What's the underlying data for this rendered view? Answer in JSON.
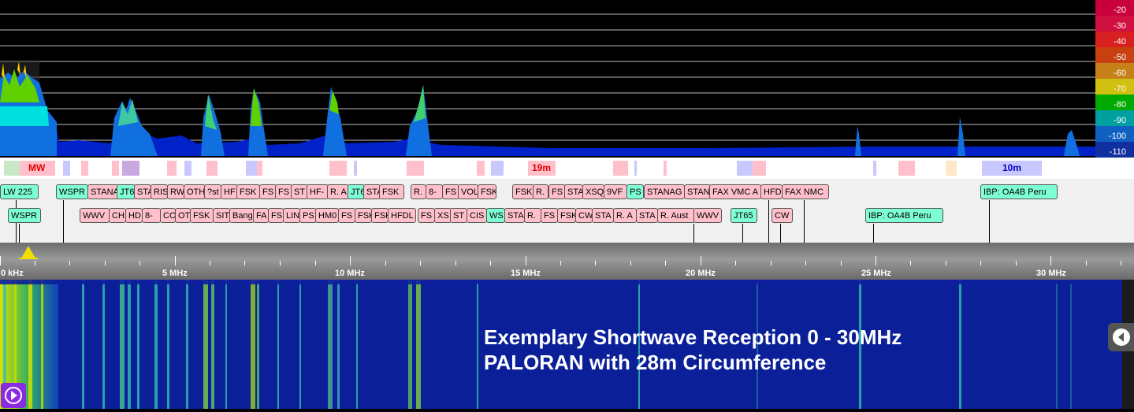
{
  "spectrum": {
    "db_scale": [
      "-20",
      "-30",
      "-40",
      "-50",
      "-60",
      "-70",
      "-80",
      "-90",
      "-100",
      "-110"
    ],
    "db_colors": [
      "#c8003c",
      "#d01040",
      "#d82020",
      "#c84010",
      "#c8801a",
      "#d0c010",
      "#00aa00",
      "#00a0a0",
      "#1060c0",
      "#1030a0"
    ]
  },
  "bands": {
    "mw_label": "MW",
    "b19m_label": "19m",
    "b10m_label": "10m"
  },
  "stations": {
    "row1": [
      "LW 225",
      "WSPR",
      "STANA",
      "JT6",
      "STA",
      "RIS",
      "RW",
      "OTH",
      "?st",
      "HF",
      "FSK",
      "FS",
      "FS",
      "ST",
      "HF-",
      "R. A",
      "JT6",
      "STA",
      "FSK",
      "R.",
      "8-",
      "FS",
      "VOL",
      "FSK",
      "FSK",
      "R.",
      "FS",
      "STA",
      "XSQ",
      "9VF",
      "PS",
      "STANAG",
      "STAN",
      "FAX VMC A",
      "HFD",
      "FAX NMC",
      "IBP: OA4B Peru"
    ],
    "row2": [
      "WSPR",
      "WWV",
      "CH",
      "HD",
      "8-",
      "CO",
      "OT",
      "FSK",
      "SIT",
      "Bang",
      "FA",
      "FS",
      "LIN",
      "PS",
      "HM0",
      "FS",
      "FSK",
      "FSK",
      "HFDL",
      "FS",
      "XS",
      "ST",
      "CIS",
      "WS",
      "STA",
      "R.",
      "FS",
      "FSK",
      "CW",
      "STA",
      "R. A",
      "STA",
      "R. Aust",
      "WWV",
      "JT65",
      "CW",
      "IBP: OA4B Peru"
    ]
  },
  "scale": {
    "labels": [
      "0 kHz",
      "5 MHz",
      "10 MHz",
      "15 MHz",
      "20 MHz",
      "25 MHz",
      "30 MHz"
    ]
  },
  "waterfall": {
    "caption_line1": "Exemplary Shortwave Reception 0 - 30MHz",
    "caption_line2": "PALORAN with 28m Circumference"
  },
  "controls": {
    "play_icon": "play-circle-icon",
    "back_icon": "chevron-left-circle-icon"
  }
}
